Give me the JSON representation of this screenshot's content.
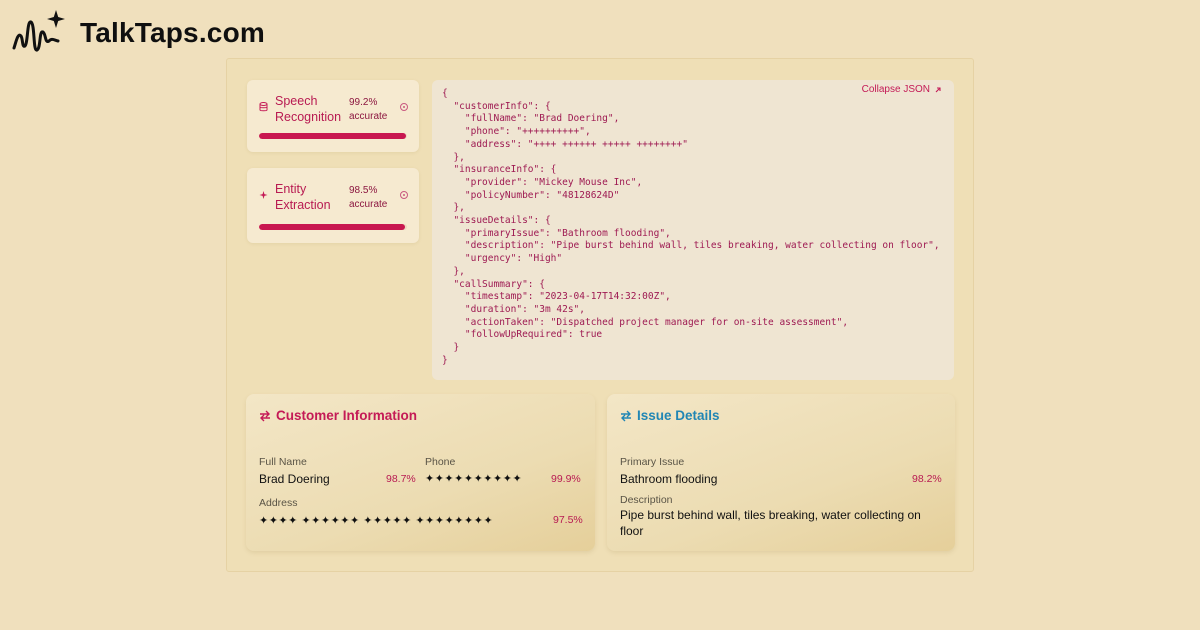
{
  "brand": {
    "name": "TalkTaps.com"
  },
  "metrics": [
    {
      "label": "Speech Recognition",
      "value": "99.2%",
      "unit": "accurate",
      "progress": 0.992,
      "icon": "database-icon"
    },
    {
      "label": "Entity Extraction",
      "value": "98.5%",
      "unit": "accurate",
      "progress": 0.985,
      "icon": "sparkle-icon"
    }
  ],
  "json_panel": {
    "collapse_label": "Collapse JSON",
    "lines": [
      "{",
      "  \"customerInfo\": {",
      "    \"fullName\": \"Brad Doering\",",
      "    \"phone\": \"++++++++++\",",
      "    \"address\": \"++++ ++++++ +++++ ++++++++\"",
      "  },",
      "  \"insuranceInfo\": {",
      "    \"provider\": \"Mickey Mouse Inc\",",
      "    \"policyNumber\": \"48128624D\"",
      "  },",
      "  \"issueDetails\": {",
      "    \"primaryIssue\": \"Bathroom flooding\",",
      "    \"description\": \"Pipe burst behind wall, tiles breaking, water collecting on floor\",",
      "    \"urgency\": \"High\"",
      "  },",
      "  \"callSummary\": {",
      "    \"timestamp\": \"2023-04-17T14:32:00Z\",",
      "    \"duration\": \"3m 42s\",",
      "    \"actionTaken\": \"Dispatched project manager for on-site assessment\",",
      "    \"followUpRequired\": true",
      "  }",
      "}"
    ]
  },
  "customer_card": {
    "title": "Customer Information",
    "full_name_label": "Full Name",
    "full_name": "Brad Doering",
    "full_name_conf": "98.7%",
    "phone_label": "Phone",
    "phone": "✦✦✦✦✦✦✦✦✦✦",
    "phone_conf": "99.9%",
    "address_label": "Address",
    "address": "✦✦✦✦ ✦✦✦✦✦✦ ✦✦✦✦✦ ✦✦✦✦✦✦✦✦",
    "address_conf": "97.5%"
  },
  "issue_card": {
    "title": "Issue Details",
    "primary_label": "Primary Issue",
    "primary": "Bathroom flooding",
    "primary_conf": "98.2%",
    "description_label": "Description",
    "description": "Pipe burst behind wall, tiles breaking, water collecting on floor"
  }
}
